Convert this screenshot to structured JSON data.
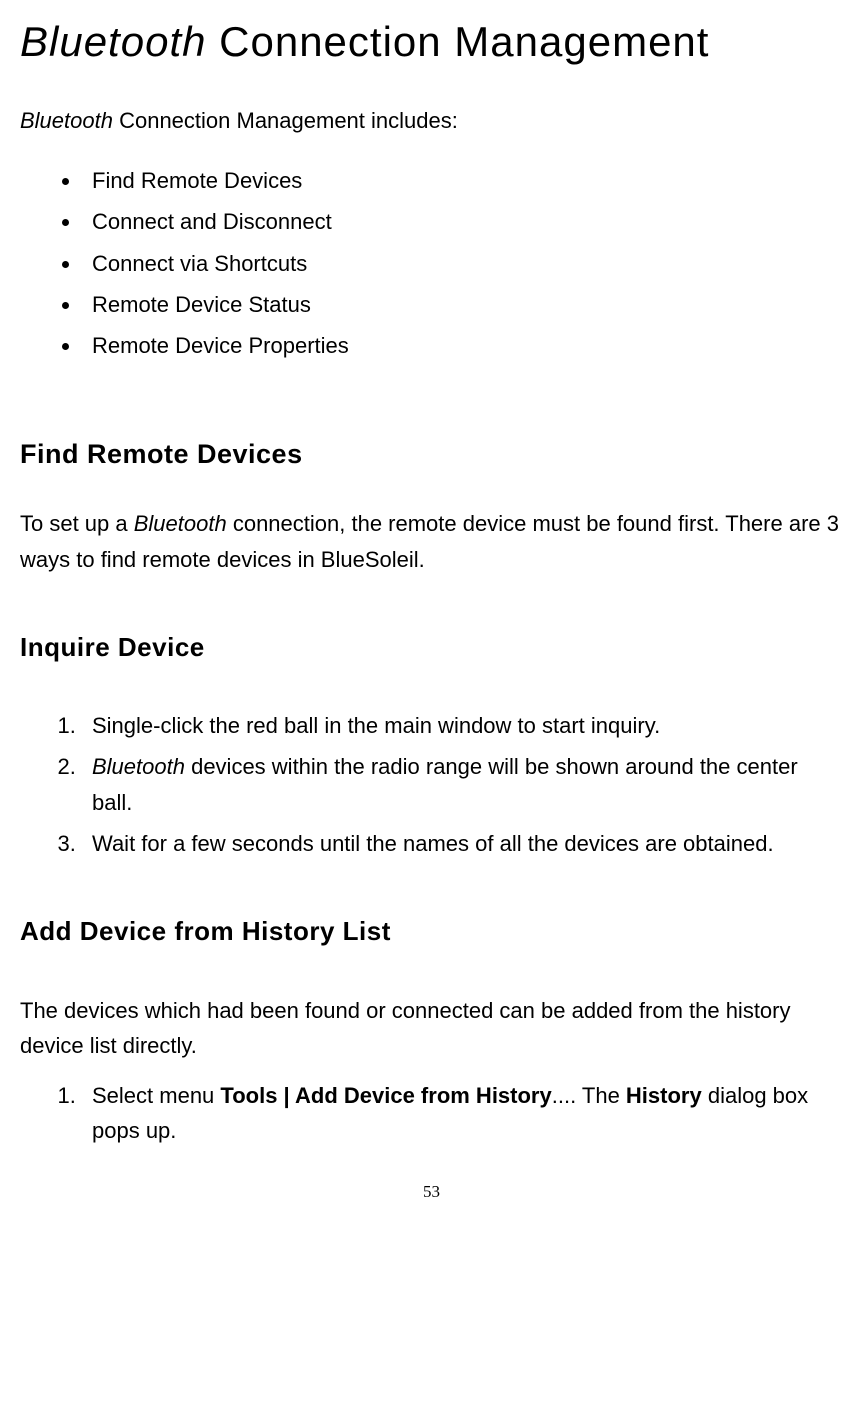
{
  "title": {
    "italic": "Bluetooth",
    "rest": " Connection Management"
  },
  "intro": {
    "italic": "Bluetooth",
    "rest": " Connection Management includes:"
  },
  "bullets": [
    "Find Remote Devices",
    "Connect and Disconnect",
    "Connect via Shortcuts",
    "Remote Device Status",
    "Remote Device Properties"
  ],
  "h2_find": "Find Remote Devices",
  "find_para": {
    "pre": "To set up a ",
    "italic": "Bluetooth",
    "post": " connection, the remote device must be found first. There are 3 ways to find remote devices in BlueSoleil."
  },
  "h3_inquire": "Inquire Device",
  "inquire_list": {
    "item1": "Single-click the red ball in the main window to start inquiry.",
    "item2_italic": "Bluetooth",
    "item2_rest": " devices within the radio range will be shown around the center ball.",
    "item3": "Wait for a few seconds until the names of all the devices are obtained."
  },
  "h3_history": "Add Device from History List",
  "history_para": "The devices which had been found or connected can be added from the history device list directly.",
  "history_list": {
    "item1_pre": "Select menu ",
    "item1_bold1": "Tools | Add Device from History",
    "item1_mid": ".... The ",
    "item1_bold2": "History",
    "item1_post": " dialog box pops up."
  },
  "page_number": "53"
}
